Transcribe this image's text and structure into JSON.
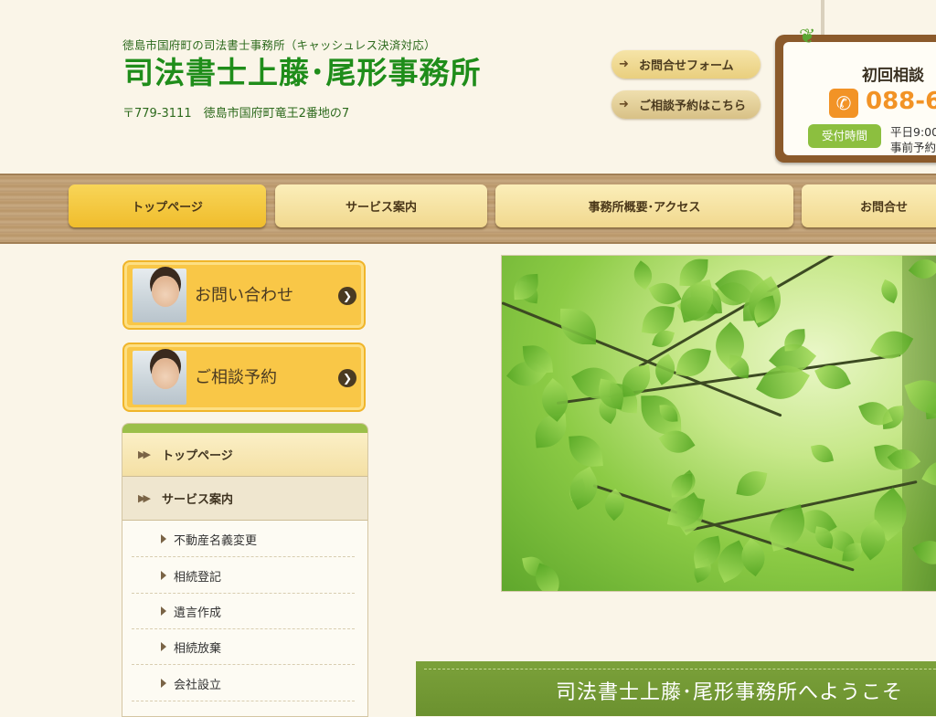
{
  "header": {
    "tagline": "徳島市国府町の司法書士事務所（キャッシュレス決済対応）",
    "title": "司法書士上藤･尾形事務所",
    "address": "〒779-3111　徳島市国府町竜王2番地の7",
    "contact_form_label": "お問合せフォーム",
    "reserve_label": "ご相談予約はこちら"
  },
  "contact_board": {
    "title": "初回相談",
    "phone": "088-6",
    "hours_badge": "受付時間",
    "hours_line1": "平日9:00",
    "hours_line2": "事前予約"
  },
  "nav": {
    "tabs": [
      {
        "label": "トップページ",
        "active": true
      },
      {
        "label": "サービス案内"
      },
      {
        "label": "事務所概要･アクセス"
      },
      {
        "label": "お問合せ"
      }
    ]
  },
  "side_cta": {
    "contact_label": "お問い合わせ",
    "reserve_label": "ご相談予約"
  },
  "side_menu": {
    "main_items": [
      "トップページ",
      "サービス案内"
    ],
    "sub_items": [
      "不動産名義変更",
      "相続登記",
      "遺言作成",
      "相続放棄",
      "会社設立"
    ]
  },
  "welcome": {
    "text": "司法書士上藤･尾形事務所へようこそ"
  },
  "colors": {
    "title_green": "#1f8d1a",
    "nav_active": "#f0bd2c",
    "phone_orange": "#f29326",
    "banner_green": "#6b912f"
  },
  "icons": {
    "arrow": "arrow-right-icon",
    "phone": "phone-icon",
    "chevron": "double-chevron-icon",
    "triangle": "triangle-right-icon"
  }
}
